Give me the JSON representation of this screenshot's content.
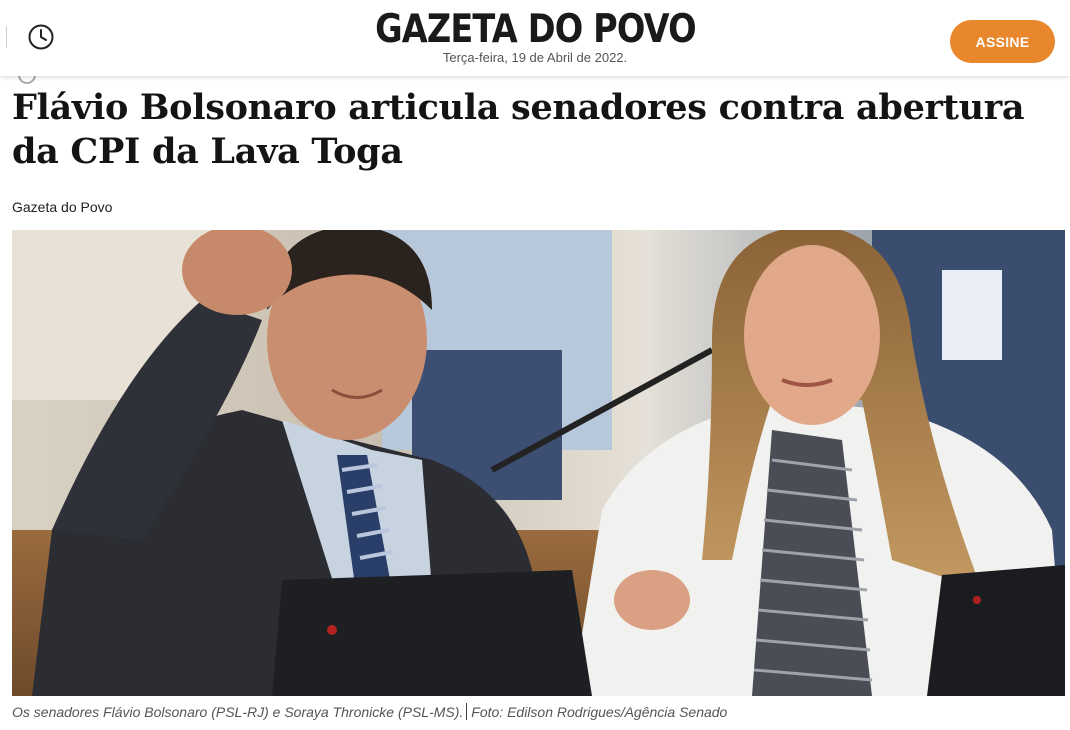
{
  "header": {
    "logo": "GAZETA DO POVO",
    "date": "Terça-feira, 19 de Abril de 2022.",
    "subscribe_label": "ASSINE",
    "history_icon": "clock-icon"
  },
  "article": {
    "headline": "Flávio Bolsonaro articula senadores contra abertura da CPI da Lava Toga",
    "byline": "Gazeta do Povo",
    "photo": {
      "caption": "Os senadores Flávio Bolsonaro (PSL-RJ) e Soraya Thronicke (PSL-MS).",
      "credit": "Foto: Edilson Rodrigues/Agência Senado"
    }
  },
  "colors": {
    "accent": "#e8872c",
    "text": "#141414",
    "muted": "#555555"
  }
}
